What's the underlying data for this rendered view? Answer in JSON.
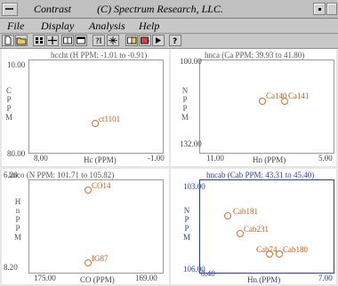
{
  "window": {
    "app_name": "Contrast",
    "title": "(C) Spectrum Research, LLC."
  },
  "menu": [
    "File",
    "Display",
    "Analysis",
    "Help"
  ],
  "toolbar": [
    "new",
    "open",
    "grid",
    "crosshair",
    "layout",
    "window",
    "peak",
    "zoom",
    "stack",
    "export",
    "play",
    "help"
  ],
  "panels": [
    {
      "title": "hccht (H PPM: -1.01 to -0.91)",
      "x_left": "8.00",
      "x_right": "-1.00",
      "x_label": "Hc (PPM)",
      "y_top": "10.00",
      "y_bottom": "80.00",
      "y_label": "C\nP\nP\nM",
      "peaks": [
        {
          "label": "ct1101"
        }
      ]
    },
    {
      "title": "hnca (Ca PPM: 39.93 to 41.80)",
      "x_left": "11.00",
      "x_right": "5.00",
      "x_label": "Hn (PPM)",
      "y_top": "100.00",
      "y_bottom": "132.00",
      "y_label": "N\nP\nP\nM",
      "peaks": [
        {
          "label": "Ca140"
        },
        {
          "label": "Ca141"
        }
      ]
    },
    {
      "title": "hnco (N PPM: 101.71 to 105.82)",
      "x_left": "175.00",
      "x_right": "169.00",
      "x_label": "CO (PPM)",
      "y_top": "6.20",
      "y_bottom": "8.20",
      "y_label": "H\nn\nP\nP\nM",
      "peaks": [
        {
          "label": "CO14"
        },
        {
          "label": "IG87"
        }
      ]
    },
    {
      "title": "hncab (Cab PPM: 43.31 to 45.40)",
      "x_left": "8.40",
      "x_right": "7.00",
      "x_label": "Hn (PPM)",
      "y_top": "103.00",
      "y_bottom": "106.00",
      "y_label": "N\nP\nP\nM",
      "peaks": [
        {
          "label": "Cab181"
        },
        {
          "label": "Cab231"
        },
        {
          "label": "Cab74"
        },
        {
          "label": "Cab180"
        }
      ]
    }
  ]
}
